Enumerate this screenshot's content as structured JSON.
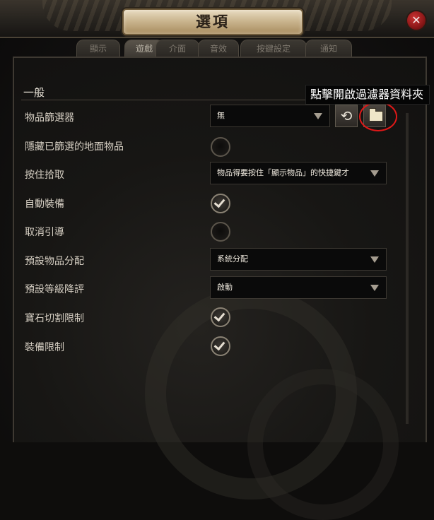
{
  "window": {
    "title": "選項",
    "close_glyph": "✕"
  },
  "tabs": [
    {
      "label": "顯示",
      "active": false
    },
    {
      "label": "遊戲",
      "active": true
    },
    {
      "label": "介面",
      "active": false
    },
    {
      "label": "音效",
      "active": false
    },
    {
      "label": "按鍵設定",
      "active": false
    },
    {
      "label": "通知",
      "active": false
    }
  ],
  "section": {
    "title": "一般"
  },
  "tooltip": {
    "text": "點擊開啟過濾器資料夾"
  },
  "settings": {
    "item_filter": {
      "label": "物品篩選器",
      "value": "無"
    },
    "hide_filtered": {
      "label": "隱藏已篩選的地面物品",
      "checked": false
    },
    "hold_pickup": {
      "label": "按住拾取",
      "value": "物品得要按住「顯示物品」的快捷鍵才"
    },
    "auto_equip": {
      "label": "自動裝備",
      "checked": true
    },
    "cancel_guide": {
      "label": "取消引導",
      "checked": false
    },
    "default_alloc": {
      "label": "預設物品分配",
      "value": "系統分配"
    },
    "default_level_down": {
      "label": "預設等級降評",
      "value": "啟動"
    },
    "gem_cut_limit": {
      "label": "寶石切割限制",
      "checked": true
    },
    "equip_limit": {
      "label": "裝備限制",
      "checked": true
    }
  },
  "icons": {
    "refresh": "refresh-icon",
    "folder": "folder-icon",
    "check": "checkmark-icon",
    "dropdown": "chevron-down-icon"
  },
  "colors": {
    "highlight_ring": "#e01818",
    "title_plate": "#cbb690",
    "close_button": "#8a1717"
  }
}
